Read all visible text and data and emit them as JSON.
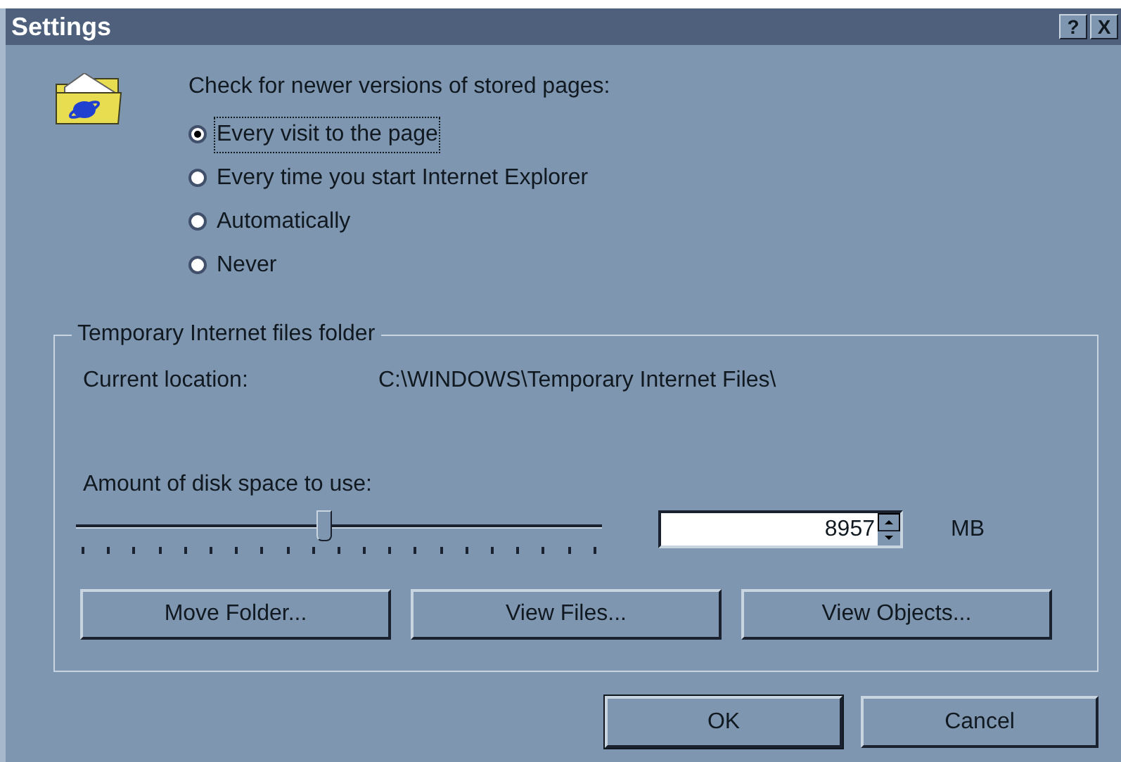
{
  "window": {
    "title": "Settings",
    "help_button": "?",
    "close_button": "X"
  },
  "check": {
    "prompt": "Check for newer versions of stored pages:",
    "options": [
      {
        "label": "Every visit to the page",
        "selected": true
      },
      {
        "label": "Every time you start Internet Explorer",
        "selected": false
      },
      {
        "label": "Automatically",
        "selected": false
      },
      {
        "label": "Never",
        "selected": false
      }
    ]
  },
  "folder": {
    "title": "Temporary Internet files folder",
    "location_label": "Current location:",
    "location": "C:\\WINDOWS\\Temporary Internet Files\\",
    "space_label": "Amount of disk space to use:",
    "slider": {
      "level": 0.47
    },
    "size": "8957",
    "unit": "MB",
    "buttons": [
      "Move Folder...",
      "View Files...",
      "View Objects..."
    ]
  },
  "buttons": [
    "OK",
    "Cancel"
  ]
}
